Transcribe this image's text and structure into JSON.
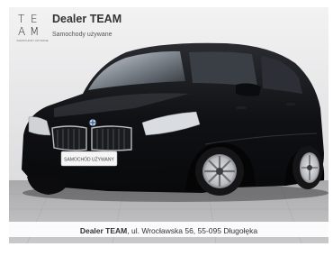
{
  "logo": {
    "letters": [
      "T",
      "E",
      "A",
      "M"
    ],
    "tagline": "SAMOCHODY UŻYWANE"
  },
  "header": {
    "brand": "Dealer TEAM",
    "subtitle": "Samochody używane"
  },
  "car": {
    "plate_text": "SAMOCHÓD UŻYWANY",
    "body_color": "#0f1013"
  },
  "footer": {
    "brand": "Dealer TEAM",
    "address": ", ul. Wrocławska 56, 55-095 Długołęka"
  },
  "colors": {
    "background": "#e9e9ea",
    "floor": "#bdbdbf",
    "car_body": "#0f1013",
    "text": "#333333"
  }
}
